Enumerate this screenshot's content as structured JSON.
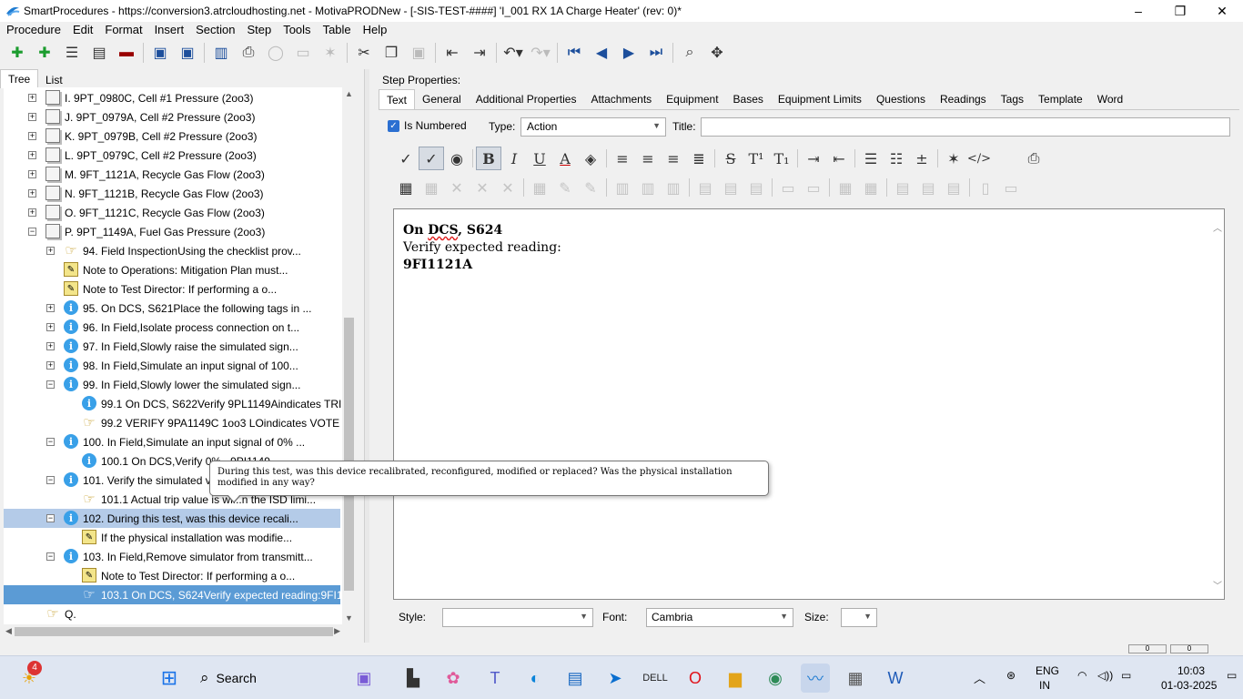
{
  "window": {
    "title": "SmartProcedures - https://conversion3.atrcloudhosting.net - MotivaPRODNew - [-SIS-TEST-####] 'I_001 RX 1A Charge Heater' (rev: 0)*",
    "minimize": "–",
    "maximize": "❐",
    "close": "✕"
  },
  "menu": [
    "Procedure",
    "Edit",
    "Format",
    "Insert",
    "Section",
    "Step",
    "Tools",
    "Table",
    "Help"
  ],
  "left_tabs": {
    "tree": "Tree",
    "list": "List"
  },
  "tree": [
    {
      "text": "I. 9PT_0980C, Cell #1 Pressure (2oo3)"
    },
    {
      "text": "J. 9PT_0979A, Cell #2 Pressure (2oo3)"
    },
    {
      "text": "K. 9PT_0979B, Cell #2 Pressure (2oo3)"
    },
    {
      "text": "L. 9PT_0979C, Cell #2 Pressure (2oo3)"
    },
    {
      "text": "M. 9FT_1121A, Recycle Gas Flow (2oo3)"
    },
    {
      "text": "N. 9FT_1121B, Recycle Gas Flow (2oo3)"
    },
    {
      "text": "O. 9FT_1121C, Recycle Gas Flow (2oo3)"
    },
    {
      "text": "P. 9PT_1149A, Fuel Gas Pressure (2oo3)"
    },
    {
      "text": "94. Field InspectionUsing the checklist prov..."
    },
    {
      "text": "Note to Operations: Mitigation Plan must..."
    },
    {
      "text": "Note to Test Director: If performing a o..."
    },
    {
      "text": "95. On DCS, S621Place the following tags in ..."
    },
    {
      "text": "96. In Field,Isolate process connection on t..."
    },
    {
      "text": "97. In Field,Slowly raise the simulated sign..."
    },
    {
      "text": "98. In Field,Simulate an input signal of 100..."
    },
    {
      "text": "99. In Field,Slowly lower the simulated sign..."
    },
    {
      "text": "99.1 On DCS, S622Verify 9PL1149Aindicates TRI..."
    },
    {
      "text": "99.2 VERIFY 9PA1149C 1oo3 LOindicates VOTE"
    },
    {
      "text": "100. In Field,Simulate an input signal of 0% ..."
    },
    {
      "text": "100.1 On DCS,Verify 0%...9PI1149..."
    },
    {
      "text": "101. Verify the simulated valu"
    },
    {
      "text": "101.1 Actual trip value is wi...n the ISD limi..."
    },
    {
      "text": "102. During this test, was this device recali..."
    },
    {
      "text": "If the physical installation was modifie..."
    },
    {
      "text": "103. In Field,Remove simulator from transmitt..."
    },
    {
      "text": "Note to Test Director: If performing a o..."
    },
    {
      "text": "103.1 On DCS, S624Verify expected reading:9FI1..."
    },
    {
      "text": "Q."
    }
  ],
  "step_props": {
    "header": "Step Properties:",
    "tabs": [
      "Text",
      "General",
      "Additional Properties",
      "Attachments",
      "Equipment",
      "Bases",
      "Equipment Limits",
      "Questions",
      "Readings",
      "Tags",
      "Template",
      "Word"
    ],
    "is_numbered_label": "Is Numbered",
    "type_label": "Type:",
    "type_value": "Action",
    "title_label": "Title:",
    "title_value": ""
  },
  "editor": {
    "line1_prefix": "On ",
    "line1_squiggle": "DCS",
    "line1_suffix": ", S624",
    "line2": "Verify expected reading:",
    "line3": "9FI1121A"
  },
  "bottom": {
    "style_label": "Style:",
    "style_value": "",
    "font_label": "Font:",
    "font_value": "Cambria",
    "size_label": "Size:",
    "size_value": ""
  },
  "tooltip": "During this test, was this device recalibrated, reconfigured, modified or replaced? Was the physical installation modified in any way?",
  "status": [
    "0",
    "0"
  ],
  "taskbar": {
    "search": "Search",
    "notif_count": "4",
    "lang1": "ENG",
    "lang2": "IN",
    "time": "10:03",
    "date": "01-03-2025"
  }
}
